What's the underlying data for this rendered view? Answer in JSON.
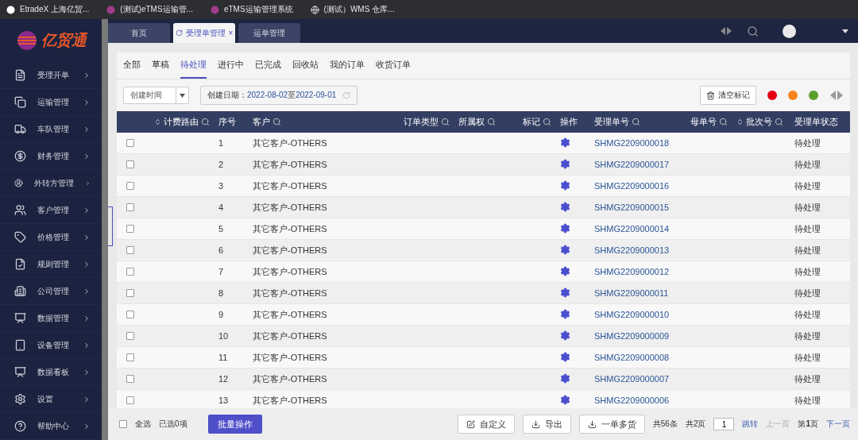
{
  "browser_tabs": [
    {
      "title": "EtradeX 上海亿贸..."
    },
    {
      "title": "(测试)eTMS运输管..."
    },
    {
      "title": "eTMS运输管理系统"
    },
    {
      "title": "(测试）WMS 仓库..."
    }
  ],
  "logo": {
    "text": "亿贸通"
  },
  "sidebar": {
    "items": [
      {
        "label": "受理开单"
      },
      {
        "label": "运输管理"
      },
      {
        "label": "车队管理"
      },
      {
        "label": "财务管理"
      },
      {
        "label": "外转方管理"
      },
      {
        "label": "客户管理"
      },
      {
        "label": "价格管理"
      },
      {
        "label": "规则管理"
      },
      {
        "label": "公司管理"
      },
      {
        "label": "数据管理"
      },
      {
        "label": "设备管理"
      },
      {
        "label": "数据看板"
      },
      {
        "label": "设置"
      },
      {
        "label": "帮助中心"
      }
    ]
  },
  "page_tabs": [
    {
      "label": "首页",
      "selected": false,
      "closable": false
    },
    {
      "label": "受理单管理",
      "selected": true,
      "closable": true,
      "close": "×"
    },
    {
      "label": "运单管理",
      "selected": false,
      "closable": false
    }
  ],
  "sub_tabs": [
    {
      "label": "全部",
      "selected": false
    },
    {
      "label": "草稿",
      "selected": false
    },
    {
      "label": "待处理",
      "selected": true
    },
    {
      "label": "进行中",
      "selected": false
    },
    {
      "label": "已完成",
      "selected": false
    },
    {
      "label": "回收站",
      "selected": false
    },
    {
      "label": "我的订单",
      "selected": false
    },
    {
      "label": "收货订单",
      "selected": false
    }
  ],
  "toolbar": {
    "date_field": {
      "value": "创建时间"
    },
    "date_range": {
      "label": "创建日期：",
      "start": "2022-08-02",
      "separator": "至",
      "end": "2022-09-01"
    },
    "clear_button": "清空标记",
    "markers": [
      {
        "color": "#e60012"
      },
      {
        "color": "#f5841f"
      },
      {
        "color": "#5aa02c"
      }
    ]
  },
  "table": {
    "columns": [
      {
        "label": "计费路由",
        "sortable": true,
        "filter": true
      },
      {
        "label": "序号",
        "sortable": false,
        "filter": false
      },
      {
        "label": "客户",
        "sortable": false,
        "filter": true
      },
      {
        "label": "订单类型",
        "sortable": false,
        "filter": true
      },
      {
        "label": "所属权",
        "sortable": false,
        "filter": true
      },
      {
        "label": "标记",
        "sortable": false,
        "filter": true
      },
      {
        "label": "操作",
        "sortable": false,
        "filter": false
      },
      {
        "label": "受理单号",
        "sortable": false,
        "filter": true
      },
      {
        "label": "母单号",
        "sortable": false,
        "filter": true
      },
      {
        "label": "批次号",
        "sortable": true,
        "filter": true
      },
      {
        "label": "受理单状态",
        "sortable": false,
        "filter": false
      }
    ],
    "rows": [
      {
        "checked": false,
        "index": "1",
        "customer": "其它客户-OTHERS",
        "order_no": "SHMG2209000018",
        "status": "待处理"
      },
      {
        "checked": false,
        "index": "2",
        "customer": "其它客户-OTHERS",
        "order_no": "SHMG2209000017",
        "status": "待处理"
      },
      {
        "checked": false,
        "index": "3",
        "customer": "其它客户-OTHERS",
        "order_no": "SHMG2209000016",
        "status": "待处理"
      },
      {
        "checked": false,
        "index": "4",
        "customer": "其它客户-OTHERS",
        "order_no": "SHMG2209000015",
        "status": "待处理"
      },
      {
        "checked": false,
        "index": "5",
        "customer": "其它客户-OTHERS",
        "order_no": "SHMG2209000014",
        "status": "待处理"
      },
      {
        "checked": false,
        "index": "6",
        "customer": "其它客户-OTHERS",
        "order_no": "SHMG2209000013",
        "status": "待处理"
      },
      {
        "checked": false,
        "index": "7",
        "customer": "其它客户-OTHERS",
        "order_no": "SHMG2209000012",
        "status": "待处理"
      },
      {
        "checked": false,
        "index": "8",
        "customer": "其它客户-OTHERS",
        "order_no": "SHMG2209000011",
        "status": "待处理"
      },
      {
        "checked": false,
        "index": "9",
        "customer": "其它客户-OTHERS",
        "order_no": "SHMG2209000010",
        "status": "待处理"
      },
      {
        "checked": false,
        "index": "10",
        "customer": "其它客户-OTHERS",
        "order_no": "SHMG2209000009",
        "status": "待处理"
      },
      {
        "checked": false,
        "index": "11",
        "customer": "其它客户-OTHERS",
        "order_no": "SHMG2209000008",
        "status": "待处理"
      },
      {
        "checked": false,
        "index": "12",
        "customer": "其它客户-OTHERS",
        "order_no": "SHMG2209000007",
        "status": "待处理"
      },
      {
        "checked": false,
        "index": "13",
        "customer": "其它客户-OTHERS",
        "order_no": "SHMG2209000006",
        "status": "待处理"
      }
    ]
  },
  "footer": {
    "select_all": {
      "label": "全选",
      "checked": false
    },
    "selected_count": "已选0项",
    "batch_button": "批量操作",
    "buttons": [
      "自定义",
      "导出",
      "一单多货"
    ],
    "pagination": {
      "total": "共56条",
      "pages": "共2页",
      "page_input": "1",
      "go": "跳转",
      "prev": {
        "label": "上一页",
        "disabled": true
      },
      "current": "第**1**页",
      "next": {
        "label": "下一页",
        "disabled": false
      }
    }
  }
}
